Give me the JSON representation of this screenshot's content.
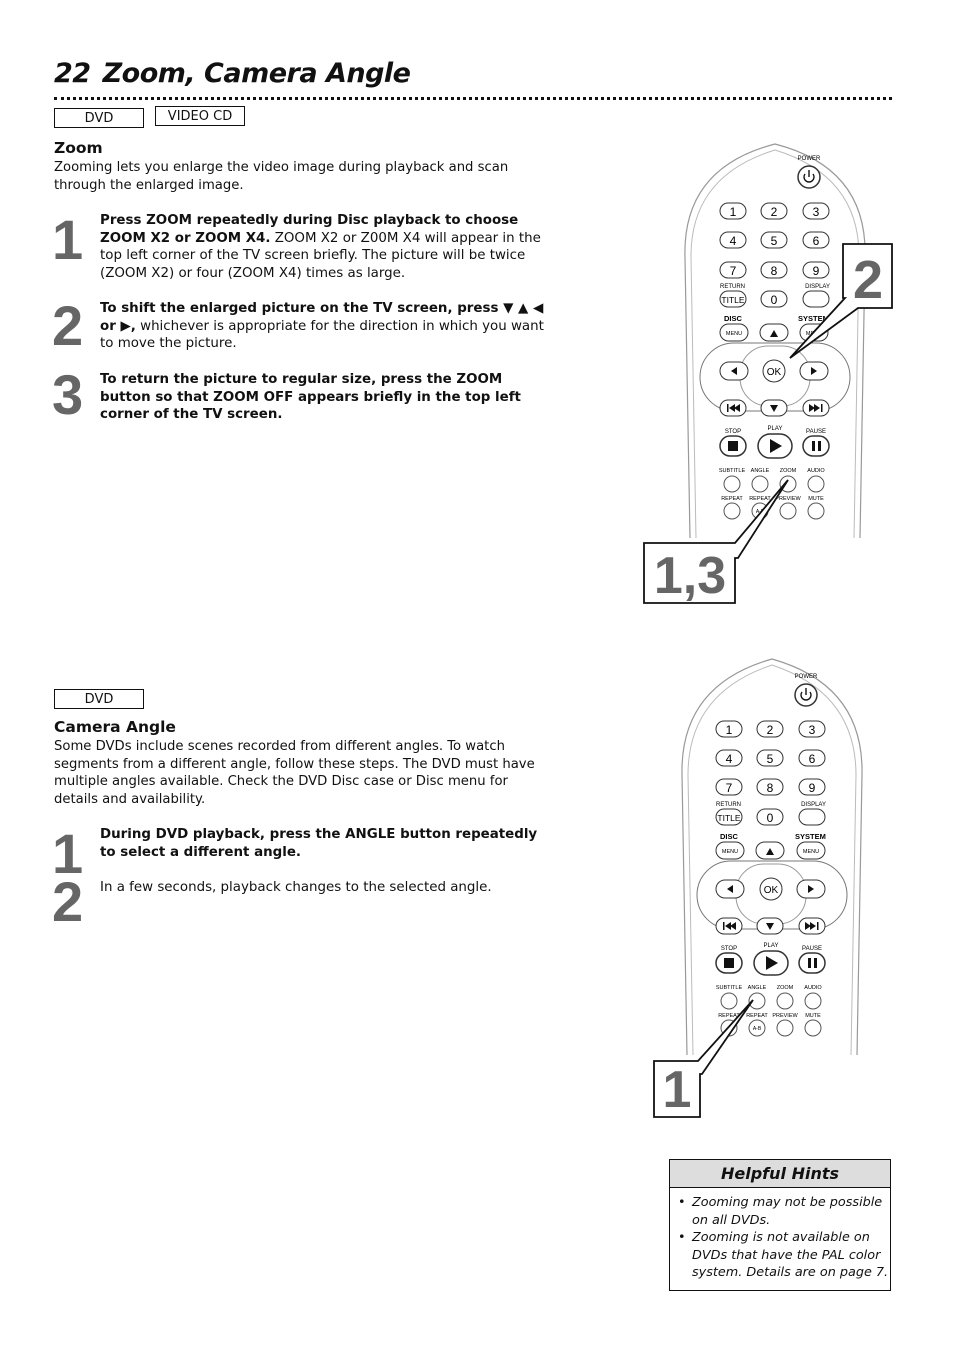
{
  "page": {
    "number": "22",
    "title": "Zoom, Camera Angle"
  },
  "zoom_section": {
    "badges": [
      "DVD",
      "VIDEO CD"
    ],
    "heading": "Zoom",
    "intro": "Zooming lets you enlarge the video image during playback and scan through the enlarged image.",
    "steps": [
      {
        "number": "1",
        "bold": "Press ZOOM repeatedly during Disc playback to choose ZOOM X2 or ZOOM X4.",
        "normal": " ZOOM X2 or Z00M X4 will appear in the top left corner of the TV screen briefly. The picture will be twice (ZOOM X2) or four (ZOOM X4) times as large."
      },
      {
        "number": "2",
        "bold": "To shift the enlarged picture on the TV screen, press ▼ ▲ ◀ or ▶,",
        "normal": " whichever is appropriate for the direction in which you want to move the picture."
      },
      {
        "number": "3",
        "bold": "To return the picture to regular size, press the ZOOM button so that ZOOM OFF appears briefly in the top left corner of the TV screen.",
        "normal": ""
      }
    ],
    "callouts": [
      "2",
      "1,3"
    ]
  },
  "angle_section": {
    "badges": [
      "DVD"
    ],
    "heading": "Camera Angle",
    "intro": "Some DVDs include scenes recorded from different angles. To watch segments from a different angle, follow these steps. The DVD must have multiple angles available. Check the DVD Disc case or Disc menu for details and availability.",
    "steps": [
      {
        "number": "1",
        "bold": "During DVD playback, press the ANGLE button repeatedly to select a different angle.",
        "normal": ""
      },
      {
        "number": "2",
        "bold": "",
        "normal": "In a few seconds, playback changes to the selected angle."
      }
    ],
    "callouts": [
      "1"
    ]
  },
  "remote": {
    "power": "POWER",
    "digits": [
      "1",
      "2",
      "3",
      "4",
      "5",
      "6",
      "7",
      "8",
      "9",
      "0"
    ],
    "return_label": "RETURN",
    "title_button": "TITLE",
    "display_label": "DISPLAY",
    "disc_label": "DISC",
    "system_label": "SYSTEM",
    "menu_button": "MENU",
    "ok_button": "OK",
    "stop_label": "STOP",
    "play_label": "PLAY",
    "pause_label": "PAUSE",
    "row1_labels": [
      "SUBTITLE",
      "ANGLE",
      "ZOOM",
      "AUDIO"
    ],
    "row2_labels": [
      "REPEAT",
      "REPEAT",
      "PREVIEW",
      "MUTE"
    ],
    "ab_button": "A-B",
    "icons": {
      "power": "power-icon",
      "up": "arrow-up-icon",
      "down": "arrow-down-icon",
      "left": "arrow-left-icon",
      "right": "arrow-right-icon",
      "prev": "skip-previous-icon",
      "next": "skip-next-icon",
      "stop": "stop-icon",
      "play": "play-icon",
      "pause": "pause-icon"
    }
  },
  "hints": {
    "heading": "Helpful Hints",
    "items": [
      "Zooming may not be possible on all DVDs.",
      "Zooming is not available on DVDs that have the PAL color system. Details are on page 7."
    ]
  }
}
